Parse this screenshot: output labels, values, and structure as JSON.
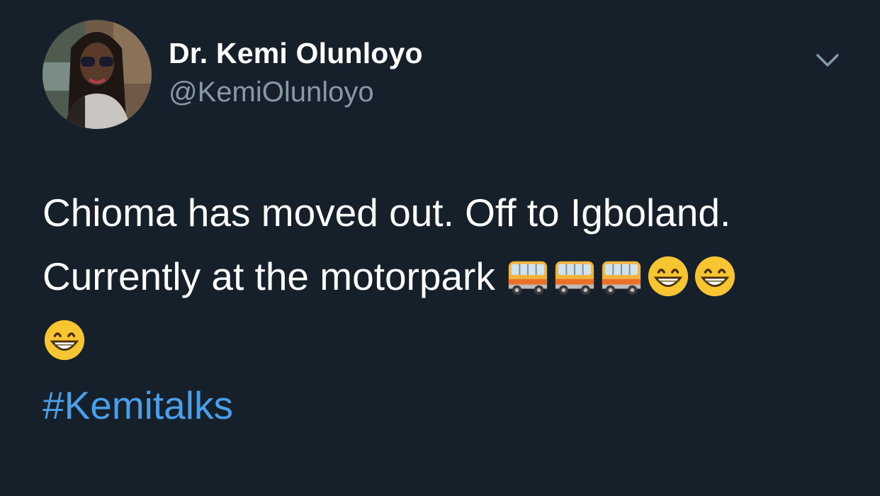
{
  "author": {
    "display_name": "Dr. Kemi Olunloyo",
    "handle": "@KemiOlunloyo",
    "avatar_icon": "profile-photo"
  },
  "menu": {
    "icon": "chevron-down-icon"
  },
  "tweet": {
    "line1": "Chioma has moved out. Off to Igboland.",
    "line2": "Currently at the motorpark",
    "line2_emojis": [
      "bus-emoji",
      "bus-emoji",
      "bus-emoji",
      "grinning-face-emoji",
      "grinning-face-emoji"
    ],
    "line3_emojis": [
      "grinning-face-emoji"
    ],
    "hashtag": "#Kemitalks"
  },
  "colors": {
    "background": "#15202b",
    "text": "#ffffff",
    "secondary_text": "#8899a6",
    "link": "#4a9fe8"
  }
}
